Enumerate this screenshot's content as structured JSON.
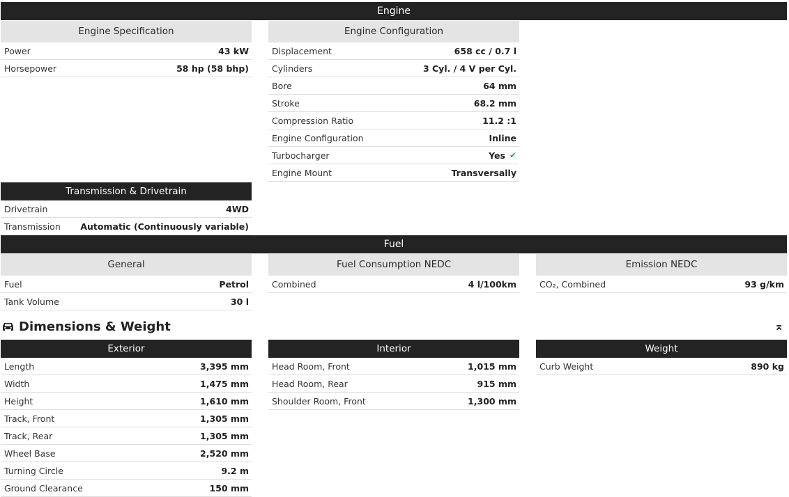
{
  "engine": {
    "title": "Engine",
    "spec": {
      "heading": "Engine Specification",
      "rows": [
        {
          "label": "Power",
          "value": "43 kW"
        },
        {
          "label": "Horsepower",
          "value": "58 hp (58 bhp)"
        }
      ]
    },
    "config": {
      "heading": "Engine Configuration",
      "rows": [
        {
          "label": "Displacement",
          "value": "658 cc / 0.7 l"
        },
        {
          "label": "Cylinders",
          "value": "3 Cyl. / 4 V per Cyl."
        },
        {
          "label": "Bore",
          "value": "64 mm"
        },
        {
          "label": "Stroke",
          "value": "68.2 mm"
        },
        {
          "label": "Compression Ratio",
          "value": "11.2 :1"
        },
        {
          "label": "Engine Configuration",
          "value": "Inline"
        },
        {
          "label": "Turbocharger",
          "value": "Yes",
          "icon": "check-icon"
        },
        {
          "label": "Engine Mount",
          "value": "Transversally"
        }
      ]
    }
  },
  "transmission": {
    "heading": "Transmission & Drivetrain",
    "rows": [
      {
        "label": "Drivetrain",
        "value": "4WD"
      },
      {
        "label": "Transmission",
        "value": "Automatic (Continuously variable)"
      }
    ]
  },
  "fuel": {
    "title": "Fuel",
    "general": {
      "heading": "General",
      "rows": [
        {
          "label": "Fuel",
          "value": "Petrol"
        },
        {
          "label": "Tank Volume",
          "value": "30 l"
        }
      ]
    },
    "consumption": {
      "heading": "Fuel Consumption NEDC",
      "rows": [
        {
          "label": "Combined",
          "value": "4 l/100km"
        }
      ]
    },
    "emission": {
      "heading": "Emission NEDC",
      "rows": [
        {
          "label": "CO₂, Combined",
          "value": "93 g/km"
        }
      ]
    }
  },
  "dimensions": {
    "title": "Dimensions & Weight",
    "icon": "car-icon",
    "top_icon": "scroll-top-icon",
    "top_glyph": "⌅",
    "exterior": {
      "heading": "Exterior",
      "rows": [
        {
          "label": "Length",
          "value": "3,395 mm"
        },
        {
          "label": "Width",
          "value": "1,475 mm"
        },
        {
          "label": "Height",
          "value": "1,610 mm"
        },
        {
          "label": "Track, Front",
          "value": "1,305 mm"
        },
        {
          "label": "Track, Rear",
          "value": "1,305 mm"
        },
        {
          "label": "Wheel Base",
          "value": "2,520 mm"
        },
        {
          "label": "Turning Circle",
          "value": "9.2 m"
        },
        {
          "label": "Ground Clearance",
          "value": "150 mm"
        }
      ]
    },
    "interior": {
      "heading": "Interior",
      "rows": [
        {
          "label": "Head Room, Front",
          "value": "1,015 mm"
        },
        {
          "label": "Head Room, Rear",
          "value": "915 mm"
        },
        {
          "label": "Shoulder Room, Front",
          "value": "1,300 mm"
        }
      ]
    },
    "weight": {
      "heading": "Weight",
      "rows": [
        {
          "label": "Curb Weight",
          "value": "890 kg"
        }
      ]
    }
  },
  "colors": {
    "dark_header": "#232323",
    "gray_header": "#e4e4e4",
    "check": "#3aa14a"
  }
}
